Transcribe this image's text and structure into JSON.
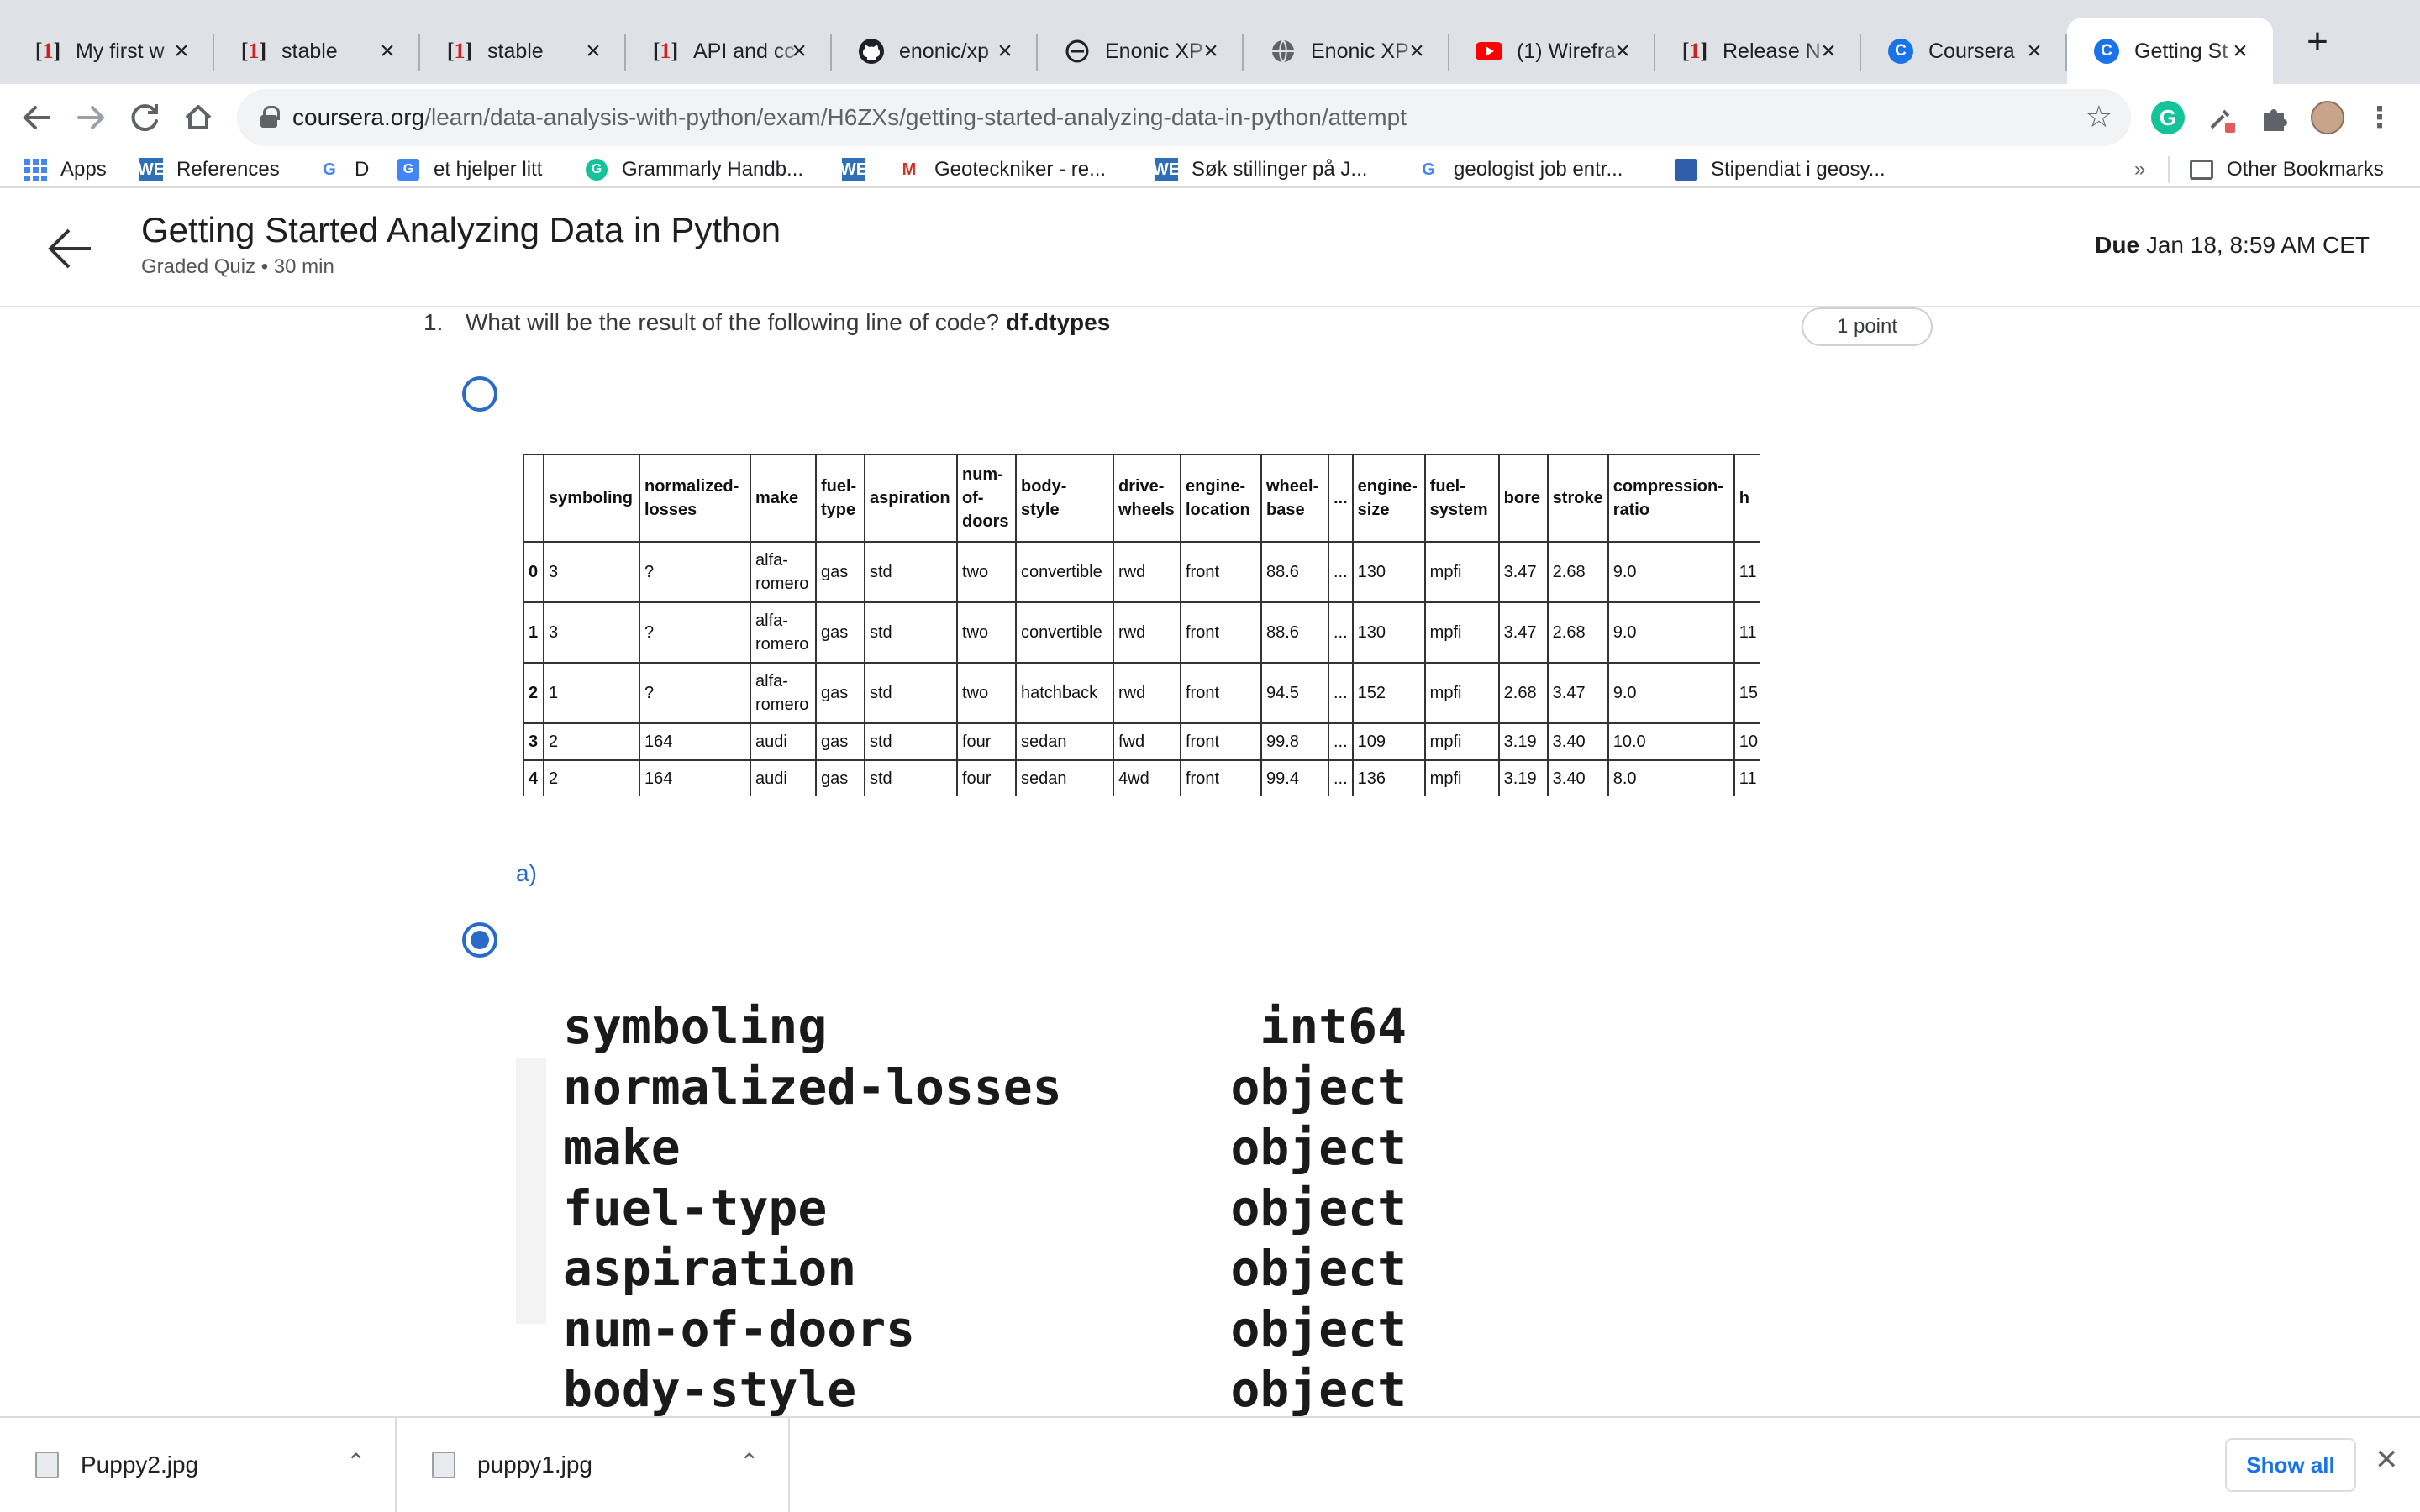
{
  "browser": {
    "tabs": [
      {
        "title": "My first w",
        "icon": "bracket-one-icon"
      },
      {
        "title": "stable",
        "icon": "bracket-one-icon"
      },
      {
        "title": "stable",
        "icon": "bracket-one-icon"
      },
      {
        "title": "API and cc",
        "icon": "bracket-one-icon"
      },
      {
        "title": "enonic/xp",
        "icon": "github-icon"
      },
      {
        "title": "Enonic XP",
        "icon": "enonic-icon"
      },
      {
        "title": "Enonic XP",
        "icon": "globe-icon"
      },
      {
        "title": "(1) Wirefra",
        "icon": "youtube-icon"
      },
      {
        "title": "Release N",
        "icon": "bracket-one-icon"
      },
      {
        "title": "Coursera",
        "icon": "coursera-icon"
      },
      {
        "title": "Getting St",
        "icon": "coursera-icon",
        "active": true
      }
    ],
    "url_domain": "coursera.org",
    "url_path": "/learn/data-analysis-with-python/exam/H6ZXs/getting-started-analyzing-data-in-python/attempt",
    "bookmarks": [
      {
        "label": "Apps",
        "icon": "apps-grid-icon"
      },
      {
        "label": "References",
        "icon": "we-icon"
      },
      {
        "label": "D",
        "icon": "google-icon"
      },
      {
        "label": "et hjelper litt",
        "icon": "translate-icon"
      },
      {
        "label": "Grammarly Handb...",
        "icon": "grammarly-icon"
      },
      {
        "label": "",
        "icon": "we-icon"
      },
      {
        "label": "Geoteckniker - re...",
        "icon": "gmail-icon"
      },
      {
        "label": "Søk stillinger på J...",
        "icon": "we-icon"
      },
      {
        "label": "geologist job entr...",
        "icon": "google-icon"
      },
      {
        "label": "Stipendiat i geosy...",
        "icon": "stipend-icon"
      }
    ],
    "overflow": "»",
    "other_bookmarks": "Other Bookmarks"
  },
  "quiz": {
    "title": "Getting Started Analyzing Data in Python",
    "subtitle": "Graded Quiz • 30 min",
    "due_label": "Due",
    "due_value": "Jan 18, 8:59 AM CET"
  },
  "question": {
    "number": "1.",
    "text": "What will be the result of the following line of code?",
    "code": "df.dtypes",
    "points": "1 point",
    "option_a_label": "a)"
  },
  "dataframe": {
    "columns": [
      "",
      "symboling",
      "normalized-\nlosses",
      "make",
      "fuel-\ntype",
      "aspiration",
      "num-\nof-\ndoors",
      "body-\nstyle",
      "drive-\nwheels",
      "engine-\nlocation",
      "wheel-\nbase",
      "...",
      "engine-\nsize",
      "fuel-\nsystem",
      "bore",
      "stroke",
      "compression-\nratio",
      "h"
    ],
    "rows": [
      [
        "0",
        "3",
        "?",
        "alfa-\nromero",
        "gas",
        "std",
        "two",
        "convertible",
        "rwd",
        "front",
        "88.6",
        "...",
        "130",
        "mpfi",
        "3.47",
        "2.68",
        "9.0",
        "11"
      ],
      [
        "1",
        "3",
        "?",
        "alfa-\nromero",
        "gas",
        "std",
        "two",
        "convertible",
        "rwd",
        "front",
        "88.6",
        "...",
        "130",
        "mpfi",
        "3.47",
        "2.68",
        "9.0",
        "11"
      ],
      [
        "2",
        "1",
        "?",
        "alfa-\nromero",
        "gas",
        "std",
        "two",
        "hatchback",
        "rwd",
        "front",
        "94.5",
        "...",
        "152",
        "mpfi",
        "2.68",
        "3.47",
        "9.0",
        "15"
      ],
      [
        "3",
        "2",
        "164",
        "audi",
        "gas",
        "std",
        "four",
        "sedan",
        "fwd",
        "front",
        "99.8",
        "...",
        "109",
        "mpfi",
        "3.19",
        "3.40",
        "10.0",
        "10"
      ],
      [
        "4",
        "2",
        "164",
        "audi",
        "gas",
        "std",
        "four",
        "sedan",
        "4wd",
        "front",
        "99.4",
        "...",
        "136",
        "mpfi",
        "3.19",
        "3.40",
        "8.0",
        "11"
      ]
    ]
  },
  "dtypes": [
    {
      "name": "symboling",
      "type": "int64"
    },
    {
      "name": "normalized-losses",
      "type": "object"
    },
    {
      "name": "make",
      "type": "object"
    },
    {
      "name": "fuel-type",
      "type": "object"
    },
    {
      "name": "aspiration",
      "type": "object"
    },
    {
      "name": "num-of-doors",
      "type": "object"
    },
    {
      "name": "body-style",
      "type": "object"
    }
  ],
  "downloads": {
    "items": [
      {
        "name": "Puppy2.jpg"
      },
      {
        "name": "puppy1.jpg"
      }
    ],
    "show_all": "Show all"
  },
  "colors": {
    "accent": "#2a6ac8",
    "tab_strip": "#dee1e6",
    "link": "#1a73e8"
  }
}
